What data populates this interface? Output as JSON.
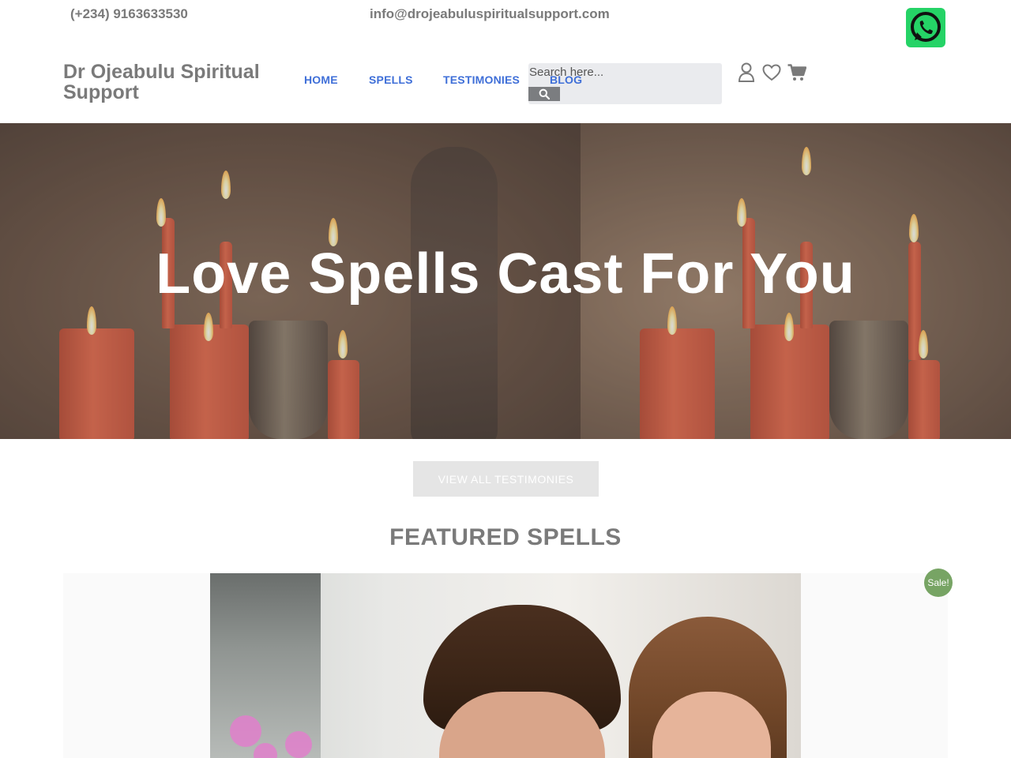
{
  "topbar": {
    "phone": "(+234) 9163633530",
    "email": "info@drojeabuluspiritualsupport.com",
    "whatsapp_icon": "whatsapp-icon"
  },
  "header": {
    "site_title": "Dr Ojeabulu Spiritual Support",
    "nav": [
      {
        "label": "HOME"
      },
      {
        "label": "SPELLS"
      },
      {
        "label": "TESTIMONIES"
      },
      {
        "label": "BLOG"
      }
    ],
    "search_placeholder": "Search here...",
    "search_icon": "search-icon",
    "icons": [
      "user-icon",
      "heart-icon",
      "cart-icon"
    ],
    "nav_color": "#3f6fd8"
  },
  "hero": {
    "title": "Love Spells Cast For You"
  },
  "testimonies_button": "VIEW ALL TESTIMONIES",
  "featured": {
    "title": "FEATURED SPELLS",
    "sale_badge": "Sale!",
    "sale_color": "#77a464"
  }
}
